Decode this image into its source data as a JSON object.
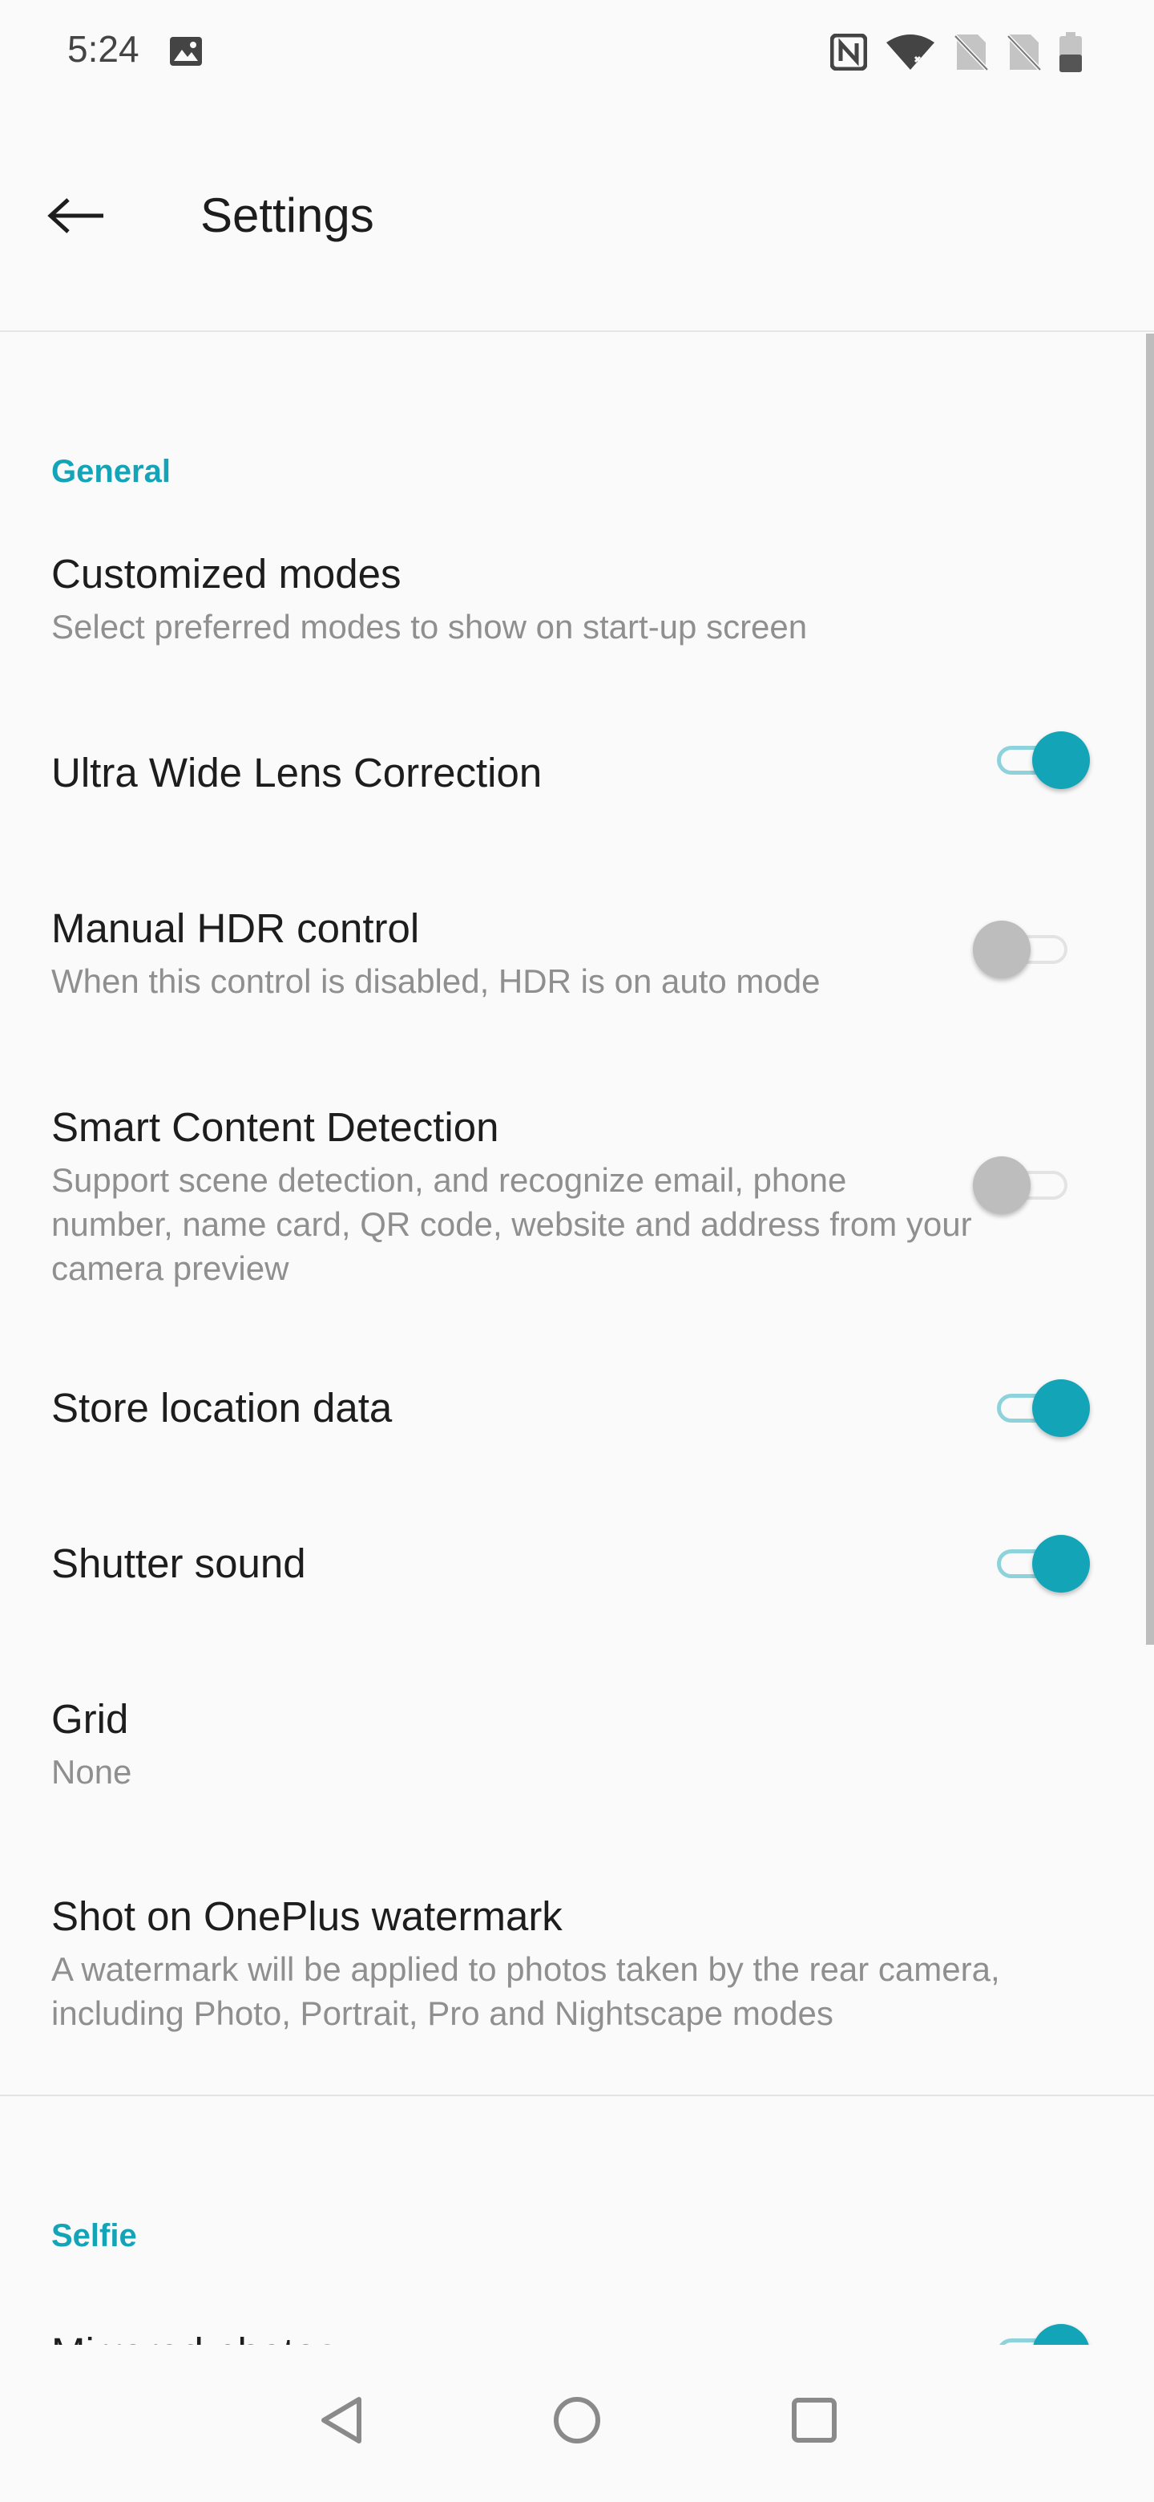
{
  "status_bar": {
    "time": "5:24",
    "icons": [
      "image-icon",
      "nfc-icon",
      "wifi-icon",
      "no-sim-icon",
      "no-sim-icon",
      "battery-icon"
    ]
  },
  "app_bar": {
    "title": "Settings",
    "back_icon": "back-arrow-icon"
  },
  "sections": {
    "general": {
      "header": "General",
      "customized_modes": {
        "title": "Customized modes",
        "subtitle": "Select preferred modes to show on start-up screen"
      },
      "ultra_wide": {
        "title": "Ultra Wide Lens Correction",
        "enabled": true
      },
      "manual_hdr": {
        "title": "Manual HDR control",
        "subtitle": "When this control is disabled, HDR is on auto mode",
        "enabled": false
      },
      "smart_content": {
        "title": "Smart Content Detection",
        "subtitle": "Support scene detection, and recognize email, phone number, name card, QR code, website and address from your camera preview",
        "enabled": false
      },
      "store_location": {
        "title": "Store location data",
        "enabled": true
      },
      "shutter_sound": {
        "title": "Shutter sound",
        "enabled": true
      },
      "grid": {
        "title": "Grid",
        "value": "None"
      },
      "watermark": {
        "title": "Shot on OnePlus watermark",
        "subtitle": "A watermark will be applied to photos taken by the rear camera, including Photo, Portrait, Pro and Nightscape modes"
      }
    },
    "selfie": {
      "header": "Selfie",
      "mirrored": {
        "title": "Mirrored photos",
        "enabled": true
      }
    }
  },
  "colors": {
    "accent": "#14a4b8",
    "accent_track": "#8ed3dc",
    "text_primary": "#1d1d1d",
    "text_secondary": "#8f8f8f",
    "background": "#fafafa"
  },
  "nav_bar": {
    "icons": [
      "back-triangle-icon",
      "home-circle-icon",
      "recents-square-icon"
    ]
  }
}
